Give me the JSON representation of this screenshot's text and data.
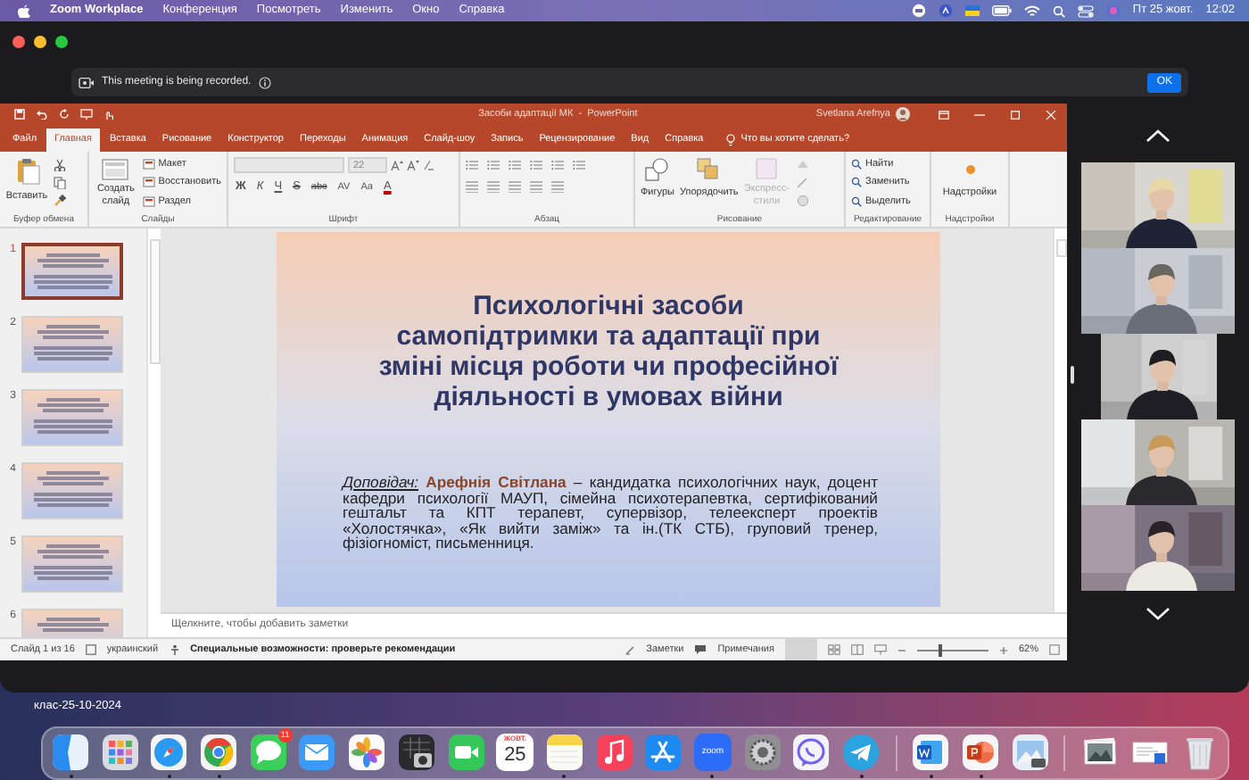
{
  "menu_bar": {
    "app": "Zoom Workplace",
    "menus": [
      "Конференция",
      "Посмотреть",
      "Изменить",
      "Окно",
      "Справка"
    ],
    "date": "Пт 25 жовт.",
    "time": "12:02"
  },
  "recording_banner": {
    "message": "This meeting is being recorded.",
    "button": "OK"
  },
  "powerpoint": {
    "title": "Засоби адаптації МК  -  PowerPoint",
    "user": "Svetlana Arefnya",
    "tabs": [
      {
        "label": "Файл",
        "selected": false
      },
      {
        "label": "Главная",
        "selected": true
      },
      {
        "label": "Вставка",
        "selected": false
      },
      {
        "label": "Рисование",
        "selected": false
      },
      {
        "label": "Конструктор",
        "selected": false
      },
      {
        "label": "Переходы",
        "selected": false
      },
      {
        "label": "Анимация",
        "selected": false
      },
      {
        "label": "Слайд-шоу",
        "selected": false
      },
      {
        "label": "Запись",
        "selected": false
      },
      {
        "label": "Рецензирование",
        "selected": false
      },
      {
        "label": "Вид",
        "selected": false
      },
      {
        "label": "Справка",
        "selected": false
      }
    ],
    "tell_me": "Что вы хотите сделать?",
    "ribbon": {
      "clipboard": {
        "paste": "Вставить",
        "label": "Буфер обмена"
      },
      "slides": {
        "new_slide": "Создать слайд",
        "layout": "Макет",
        "reset": "Восстановить",
        "section": "Раздел",
        "label": "Слайды"
      },
      "font": {
        "font_size": "22",
        "format_buttons": [
          "Ж",
          "К",
          "Ч",
          "S",
          "abc",
          "AV",
          "Aa",
          "A"
        ],
        "label": "Шрифт"
      },
      "paragraph": {
        "label": "Абзац"
      },
      "drawing": {
        "shapes": "Фигуры",
        "arrange": "Упорядочить",
        "quick_styles": {
          "label": "Экспресс-стили",
          "disabled": true
        },
        "label": "Рисование"
      },
      "editing": {
        "find": "Найти",
        "replace": "Заменить",
        "select": "Выделить",
        "label": "Редактирование"
      },
      "addins": {
        "button": "Надстройки",
        "label": "Надстройки"
      }
    },
    "thumbnails": [
      {
        "number": "1",
        "selected": true
      },
      {
        "number": "2",
        "selected": false
      },
      {
        "number": "3",
        "selected": false
      },
      {
        "number": "4",
        "selected": false
      },
      {
        "number": "5",
        "selected": false
      },
      {
        "number": "6",
        "selected": false
      }
    ],
    "slide": {
      "title": "Психологічні засоби\nсамопідтримки та адаптації при\nзміні місця роботи чи професійної\nдіяльності в умовах війни",
      "body": "*Доповідач:* **Арефнія Світлана** – кандидатка психологічних наук, доцент кафедри психології МАУП, сімейна психотерапевтка, сертифікований гештальт та КПТ терапевт, супервізор, телеексперт проектів «Холостячка», «Як вийти заміж» та ін.(ТК СТБ), груповий тренер, фізіогноміст, письменниця."
    },
    "notes_placeholder": "Щелкните, чтобы добавить заметки",
    "status_bar": {
      "slide_counter": "Слайд 1 из 16",
      "language": "украинский",
      "accessibility": "Специальные возможности: проверьте рекомендации",
      "notes": "Заметки",
      "comments": "Примечания",
      "zoom_slider": {
        "level": 0.3
      },
      "zoom": "62%"
    }
  },
  "desktop": {
    "folder_label": "клас-25-10-2024"
  },
  "dock": [
    {
      "kind": "finder",
      "running": true
    },
    {
      "kind": "launchpad",
      "running": false
    },
    {
      "kind": "safari",
      "running": true
    },
    {
      "kind": "chrome",
      "running": true
    },
    {
      "kind": "messages",
      "running": false,
      "badge": "11"
    },
    {
      "kind": "mail",
      "running": false
    },
    {
      "kind": "photos",
      "running": false
    },
    {
      "kind": "image_capture",
      "running": false
    },
    {
      "kind": "facetime",
      "running": false
    },
    {
      "kind": "calendar",
      "running": false,
      "month": "ЖОВТ.",
      "day": "25"
    },
    {
      "kind": "notes",
      "running": true
    },
    {
      "kind": "music",
      "running": false
    },
    {
      "kind": "app_store",
      "running": false
    },
    {
      "kind": "zoom",
      "running": true,
      "label": "zoom"
    },
    {
      "kind": "settings",
      "running": false
    },
    {
      "kind": "viber",
      "running": false
    },
    {
      "kind": "telegram",
      "running": true
    },
    {
      "kind": "separator"
    },
    {
      "kind": "word",
      "running": true
    },
    {
      "kind": "powerpoint",
      "running": true
    },
    {
      "kind": "preview",
      "running": false
    },
    {
      "kind": "separator"
    },
    {
      "kind": "photo_stack",
      "running": false
    },
    {
      "kind": "document_stack",
      "running": false
    },
    {
      "kind": "trash",
      "running": false
    }
  ]
}
